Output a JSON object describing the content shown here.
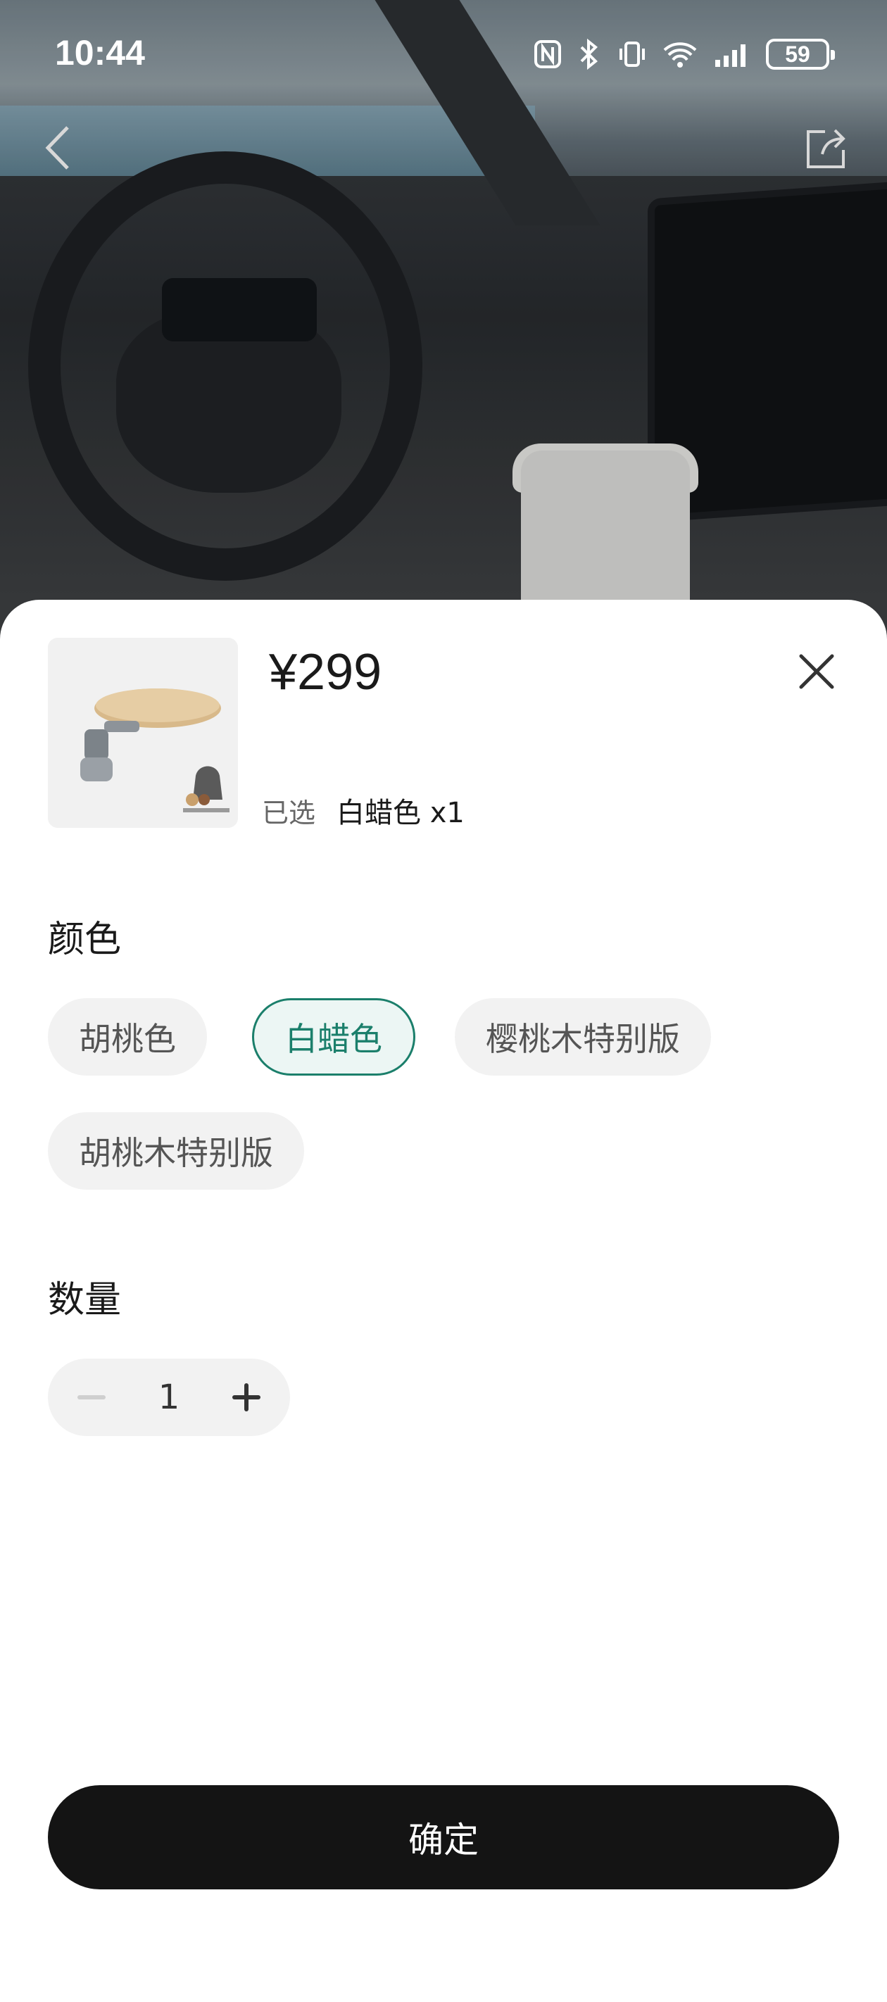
{
  "status_bar": {
    "time": "10:44",
    "battery": "59",
    "icons": [
      "nfc-icon",
      "bluetooth-icon",
      "vibrate-icon",
      "wifi-icon",
      "signal-icon",
      "battery-icon"
    ]
  },
  "nav": {
    "back_icon": "chevron-left-icon",
    "share_icon": "share-icon"
  },
  "sheet": {
    "price": "¥299",
    "selected_label": "已选",
    "selected_value": "白蜡色 x1",
    "color_section_title": "颜色",
    "colors": [
      {
        "label": "胡桃色",
        "selected": false
      },
      {
        "label": "白蜡色",
        "selected": true
      },
      {
        "label": "樱桃木特别版",
        "selected": false
      },
      {
        "label": "胡桃木特别版",
        "selected": false
      }
    ],
    "quantity_section_title": "数量",
    "quantity": "1",
    "confirm_label": "确定"
  },
  "colors": {
    "accent": "#1b7f6b",
    "chip_bg": "#f2f2f2",
    "button_bg": "#141414"
  }
}
